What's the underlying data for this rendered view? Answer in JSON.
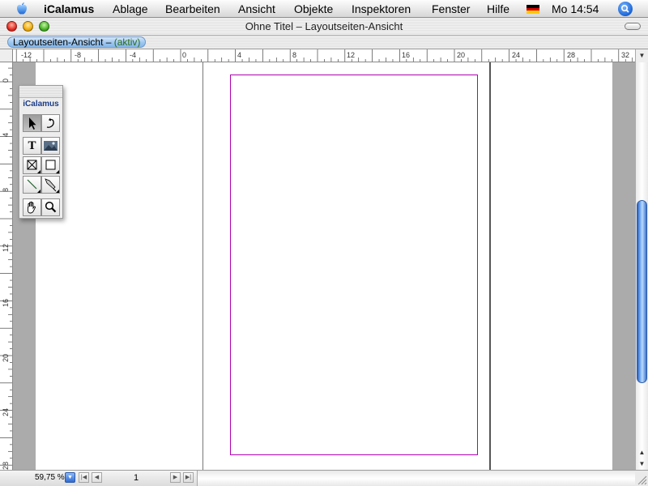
{
  "menubar": {
    "app_name": "iCalamus",
    "menus": [
      "Ablage",
      "Bearbeiten",
      "Ansicht",
      "Objekte",
      "Inspektoren",
      "Fenster",
      "Hilfe"
    ],
    "clock": "Mo 14:54",
    "icons": [
      "apple-logo",
      "german-flag",
      "spotlight-icon"
    ]
  },
  "window": {
    "title": "Ohne Titel – Layoutseiten-Ansicht",
    "tab": {
      "label": "Layoutseiten-Ansicht –",
      "status": "(aktiv)"
    }
  },
  "rulers": {
    "horizontal_labels": [
      "12",
      "8",
      "4",
      "0",
      "4",
      "8",
      "12",
      "16",
      "20",
      "24",
      "28",
      "32"
    ],
    "vertical_labels": [
      "0",
      "4",
      "8",
      "12",
      "16",
      "20",
      "24",
      "28"
    ]
  },
  "palette": {
    "title": "iCalamus",
    "tools": [
      "select-tool",
      "rotate-tool",
      "text-tool",
      "image-tool",
      "frame-tool",
      "rectangle-tool",
      "line-tool",
      "pen-tool",
      "hand-tool",
      "zoom-tool"
    ]
  },
  "statusbar": {
    "zoom": "59,75 %",
    "page_number": "1"
  },
  "colors": {
    "margin_frame": "#b000b0",
    "accent": "#3b74d0"
  }
}
